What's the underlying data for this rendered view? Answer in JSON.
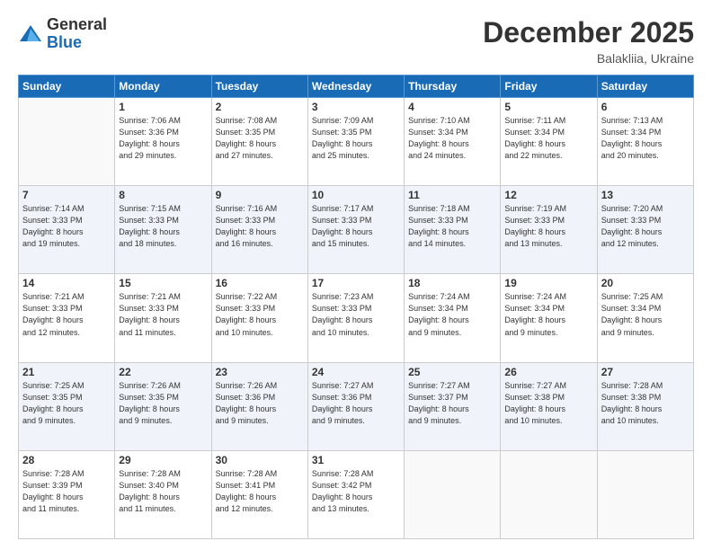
{
  "logo": {
    "general": "General",
    "blue": "Blue"
  },
  "title": "December 2025",
  "location": "Balakliia, Ukraine",
  "days_of_week": [
    "Sunday",
    "Monday",
    "Tuesday",
    "Wednesday",
    "Thursday",
    "Friday",
    "Saturday"
  ],
  "weeks": [
    [
      {
        "day": "",
        "info": ""
      },
      {
        "day": "1",
        "info": "Sunrise: 7:06 AM\nSunset: 3:36 PM\nDaylight: 8 hours\nand 29 minutes."
      },
      {
        "day": "2",
        "info": "Sunrise: 7:08 AM\nSunset: 3:35 PM\nDaylight: 8 hours\nand 27 minutes."
      },
      {
        "day": "3",
        "info": "Sunrise: 7:09 AM\nSunset: 3:35 PM\nDaylight: 8 hours\nand 25 minutes."
      },
      {
        "day": "4",
        "info": "Sunrise: 7:10 AM\nSunset: 3:34 PM\nDaylight: 8 hours\nand 24 minutes."
      },
      {
        "day": "5",
        "info": "Sunrise: 7:11 AM\nSunset: 3:34 PM\nDaylight: 8 hours\nand 22 minutes."
      },
      {
        "day": "6",
        "info": "Sunrise: 7:13 AM\nSunset: 3:34 PM\nDaylight: 8 hours\nand 20 minutes."
      }
    ],
    [
      {
        "day": "7",
        "info": "Sunrise: 7:14 AM\nSunset: 3:33 PM\nDaylight: 8 hours\nand 19 minutes."
      },
      {
        "day": "8",
        "info": "Sunrise: 7:15 AM\nSunset: 3:33 PM\nDaylight: 8 hours\nand 18 minutes."
      },
      {
        "day": "9",
        "info": "Sunrise: 7:16 AM\nSunset: 3:33 PM\nDaylight: 8 hours\nand 16 minutes."
      },
      {
        "day": "10",
        "info": "Sunrise: 7:17 AM\nSunset: 3:33 PM\nDaylight: 8 hours\nand 15 minutes."
      },
      {
        "day": "11",
        "info": "Sunrise: 7:18 AM\nSunset: 3:33 PM\nDaylight: 8 hours\nand 14 minutes."
      },
      {
        "day": "12",
        "info": "Sunrise: 7:19 AM\nSunset: 3:33 PM\nDaylight: 8 hours\nand 13 minutes."
      },
      {
        "day": "13",
        "info": "Sunrise: 7:20 AM\nSunset: 3:33 PM\nDaylight: 8 hours\nand 12 minutes."
      }
    ],
    [
      {
        "day": "14",
        "info": "Sunrise: 7:21 AM\nSunset: 3:33 PM\nDaylight: 8 hours\nand 12 minutes."
      },
      {
        "day": "15",
        "info": "Sunrise: 7:21 AM\nSunset: 3:33 PM\nDaylight: 8 hours\nand 11 minutes."
      },
      {
        "day": "16",
        "info": "Sunrise: 7:22 AM\nSunset: 3:33 PM\nDaylight: 8 hours\nand 10 minutes."
      },
      {
        "day": "17",
        "info": "Sunrise: 7:23 AM\nSunset: 3:33 PM\nDaylight: 8 hours\nand 10 minutes."
      },
      {
        "day": "18",
        "info": "Sunrise: 7:24 AM\nSunset: 3:34 PM\nDaylight: 8 hours\nand 9 minutes."
      },
      {
        "day": "19",
        "info": "Sunrise: 7:24 AM\nSunset: 3:34 PM\nDaylight: 8 hours\nand 9 minutes."
      },
      {
        "day": "20",
        "info": "Sunrise: 7:25 AM\nSunset: 3:34 PM\nDaylight: 8 hours\nand 9 minutes."
      }
    ],
    [
      {
        "day": "21",
        "info": "Sunrise: 7:25 AM\nSunset: 3:35 PM\nDaylight: 8 hours\nand 9 minutes."
      },
      {
        "day": "22",
        "info": "Sunrise: 7:26 AM\nSunset: 3:35 PM\nDaylight: 8 hours\nand 9 minutes."
      },
      {
        "day": "23",
        "info": "Sunrise: 7:26 AM\nSunset: 3:36 PM\nDaylight: 8 hours\nand 9 minutes."
      },
      {
        "day": "24",
        "info": "Sunrise: 7:27 AM\nSunset: 3:36 PM\nDaylight: 8 hours\nand 9 minutes."
      },
      {
        "day": "25",
        "info": "Sunrise: 7:27 AM\nSunset: 3:37 PM\nDaylight: 8 hours\nand 9 minutes."
      },
      {
        "day": "26",
        "info": "Sunrise: 7:27 AM\nSunset: 3:38 PM\nDaylight: 8 hours\nand 10 minutes."
      },
      {
        "day": "27",
        "info": "Sunrise: 7:28 AM\nSunset: 3:38 PM\nDaylight: 8 hours\nand 10 minutes."
      }
    ],
    [
      {
        "day": "28",
        "info": "Sunrise: 7:28 AM\nSunset: 3:39 PM\nDaylight: 8 hours\nand 11 minutes."
      },
      {
        "day": "29",
        "info": "Sunrise: 7:28 AM\nSunset: 3:40 PM\nDaylight: 8 hours\nand 11 minutes."
      },
      {
        "day": "30",
        "info": "Sunrise: 7:28 AM\nSunset: 3:41 PM\nDaylight: 8 hours\nand 12 minutes."
      },
      {
        "day": "31",
        "info": "Sunrise: 7:28 AM\nSunset: 3:42 PM\nDaylight: 8 hours\nand 13 minutes."
      },
      {
        "day": "",
        "info": ""
      },
      {
        "day": "",
        "info": ""
      },
      {
        "day": "",
        "info": ""
      }
    ]
  ]
}
